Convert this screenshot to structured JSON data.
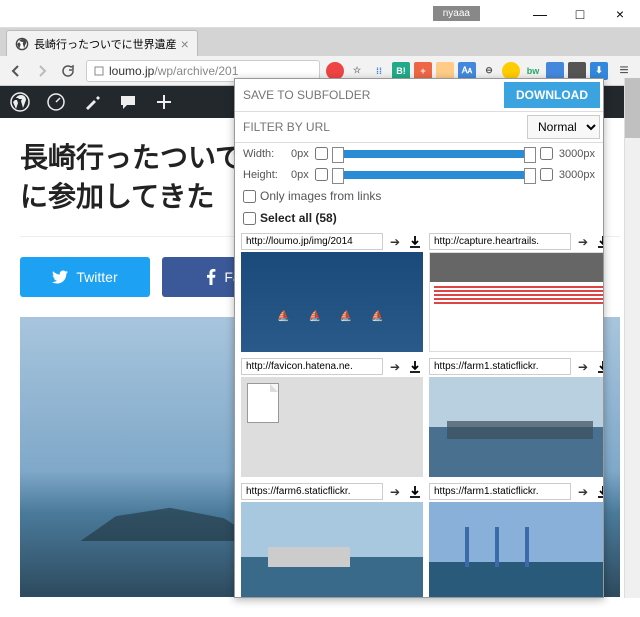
{
  "window": {
    "user": "nyaaa",
    "minimize": "—",
    "maximize": "□",
    "close": "×"
  },
  "tab": {
    "title": "長崎行ったついでに世界遺産",
    "close": "×"
  },
  "url": {
    "host": "loumo.jp",
    "path": "/wp/archive/201"
  },
  "page": {
    "title": "長崎行ったついでに世界遺産候補の軍艦島上陸ツアーに参加してきた",
    "title_visible": "長崎行ったついでに\nに参加してきた",
    "twitter": "Twitter",
    "facebook": "Fac"
  },
  "panel": {
    "subfolder_placeholder": "SAVE TO SUBFOLDER",
    "download": "DOWNLOAD",
    "filter_placeholder": "FILTER BY URL",
    "mode": "Normal",
    "width_label": "Width:",
    "height_label": "Height:",
    "min_px": "0px",
    "max_px": "3000px",
    "only_links": "Only images from links",
    "select_all": "Select all (58)"
  },
  "items": [
    {
      "url": "http://loumo.jp/img/2014",
      "thumb": "sea"
    },
    {
      "url": "http://capture.heartrails.",
      "thumb": "page"
    },
    {
      "url": "http://favicon.hatena.ne.",
      "thumb": "file"
    },
    {
      "url": "https://farm1.staticflickr.",
      "thumb": "harbor"
    },
    {
      "url": "https://farm6.staticflickr.",
      "thumb": "ship"
    },
    {
      "url": "https://farm1.staticflickr.",
      "thumb": "crane"
    }
  ]
}
